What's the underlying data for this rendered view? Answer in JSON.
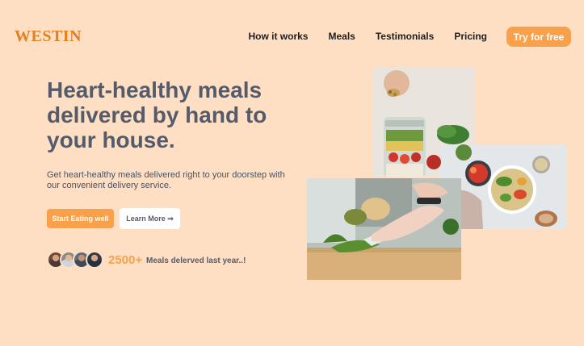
{
  "brand": {
    "logo": "WESTIN",
    "accent": "#f9a04a"
  },
  "nav": {
    "items": [
      "How it works",
      "Meals",
      "Testimonials",
      "Pricing"
    ],
    "cta": "Try for free"
  },
  "hero": {
    "title": "Heart-healthy meals delivered by hand to your house.",
    "description": "Get heart-healthy meals delivered right to your doorstep with our convenient delivery service.",
    "primary_button": "Start Eating well",
    "secondary_button": "Learn More ⇒"
  },
  "social_proof": {
    "count": "2500+",
    "label": "Meals delerved last year..!"
  },
  "images": {
    "jar": "salad-jar-photo",
    "bowl": "grain-bowl-photo",
    "cutting": "chopping-herbs-photo"
  }
}
